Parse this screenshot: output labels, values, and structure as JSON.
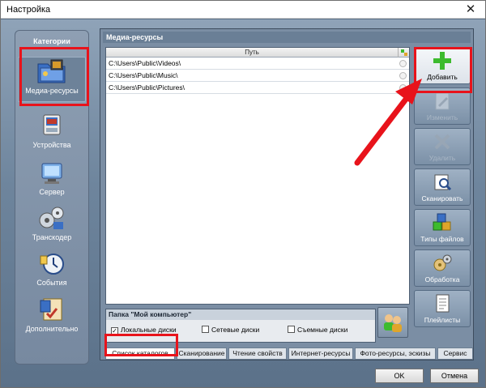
{
  "window": {
    "title": "Настройка",
    "close_glyph": "✕"
  },
  "sidebar": {
    "header": "Категории",
    "items": [
      {
        "label": "Медиа-ресурсы",
        "icon": "media-folder-icon",
        "selected": true
      },
      {
        "label": "Устройства",
        "icon": "devices-icon"
      },
      {
        "label": "Сервер",
        "icon": "server-icon"
      },
      {
        "label": "Транскодер",
        "icon": "transcoder-icon"
      },
      {
        "label": "События",
        "icon": "events-icon"
      },
      {
        "label": "Дополнительно",
        "icon": "additional-icon"
      }
    ]
  },
  "panel": {
    "header": "Медиа-ресурсы",
    "list": {
      "column_path": "Путь",
      "rows": [
        "C:\\Users\\Public\\Videos\\",
        "C:\\Users\\Public\\Music\\",
        "C:\\Users\\Public\\Pictures\\"
      ]
    },
    "folder": {
      "title": "Папка \"Мой компьютер\"",
      "local_disks": "Локальные диски",
      "network_disks": "Сетевые диски",
      "removable_disks": "Съемные диски"
    }
  },
  "buttons": {
    "add": "Добавить",
    "edit": "Изменить",
    "delete": "Удалить",
    "scan": "Сканировать",
    "file_types": "Типы файлов",
    "processing": "Обработка",
    "playlists": "Плейлисты"
  },
  "tabs": [
    "Список каталогов",
    "Сканирование",
    "Чтение свойств",
    "Интернет-ресурсы",
    "Фото-ресурсы, эскизы",
    "Сервис"
  ],
  "dialog": {
    "ok": "OK",
    "cancel": "Отмена"
  },
  "colors": {
    "highlight": "#e8131b",
    "add_plus": "#3dbb2e",
    "background": "#6e859d"
  }
}
